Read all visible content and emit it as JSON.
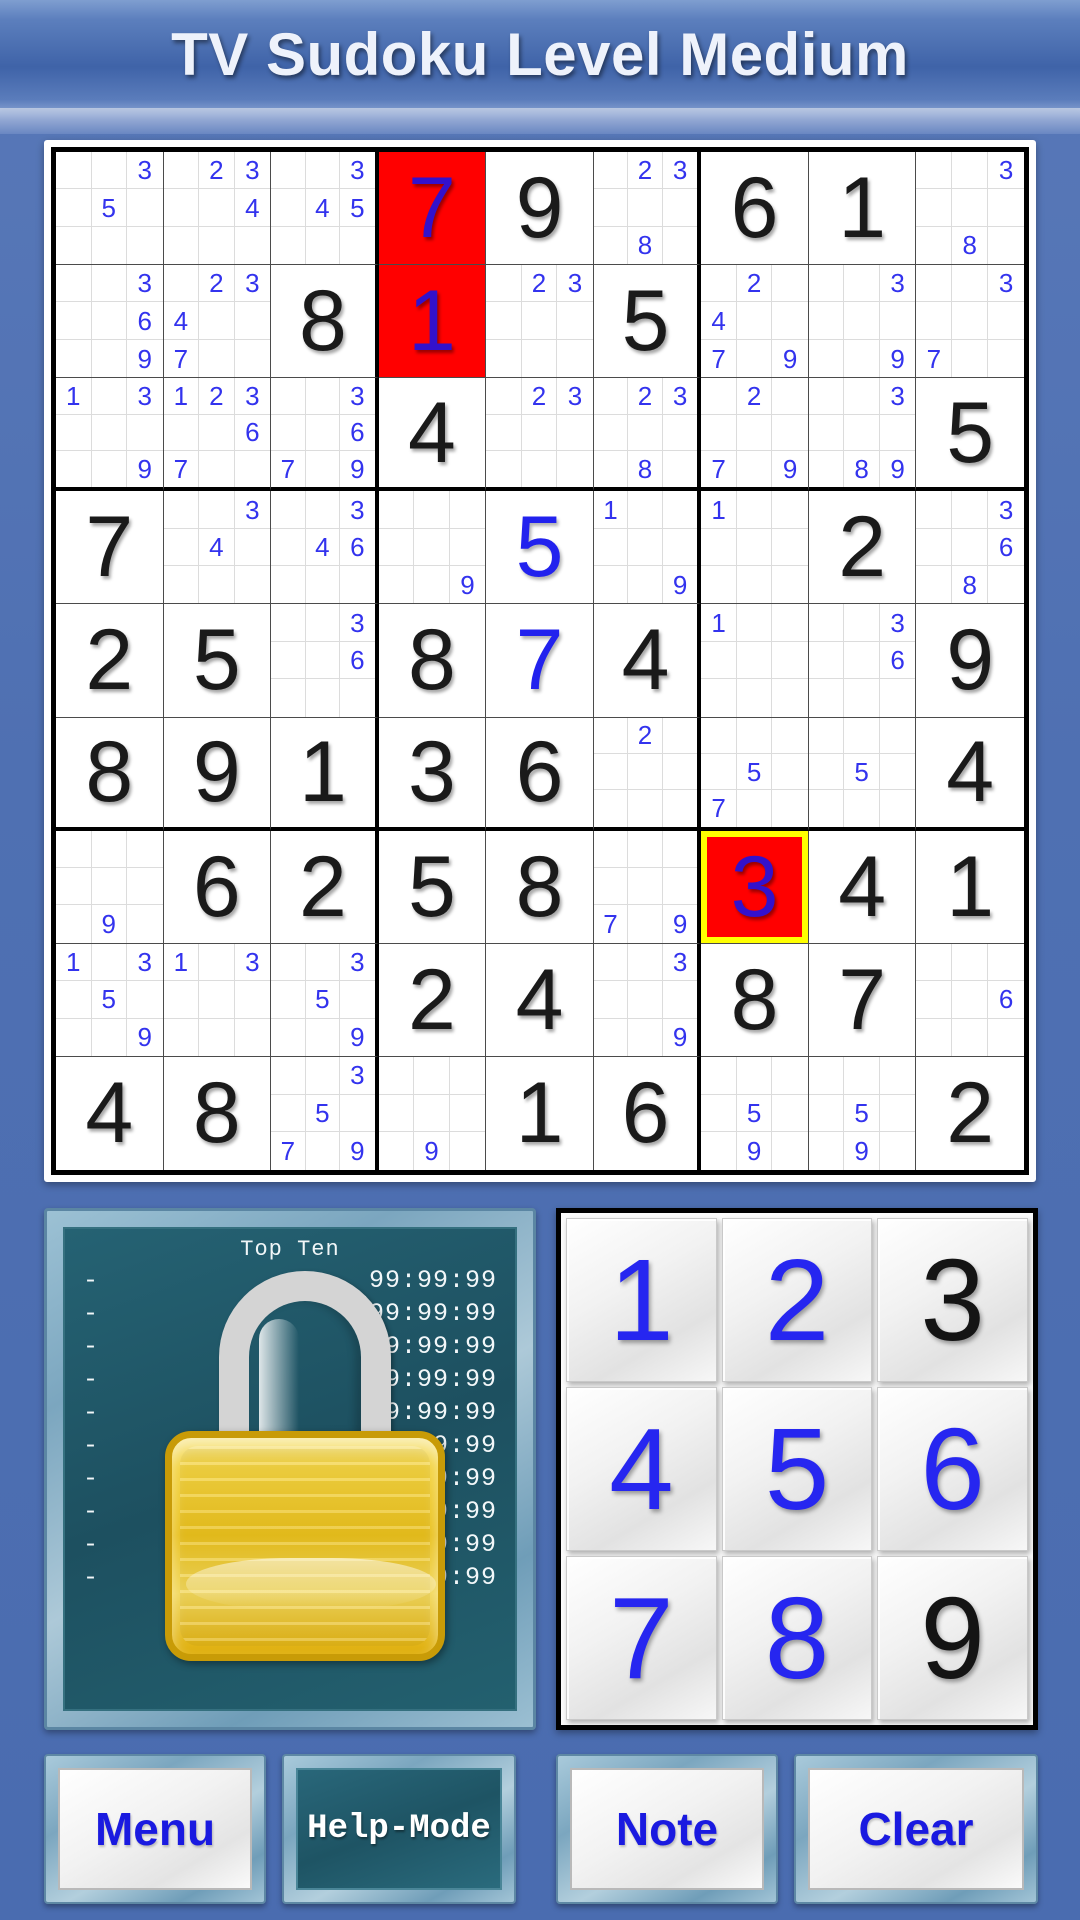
{
  "header": {
    "title": "TV Sudoku Level Medium"
  },
  "board": {
    "selected_cells": [
      {
        "row": 1,
        "col": 3,
        "style": "red"
      },
      {
        "row": 6,
        "col": 6,
        "style": "red-yellow"
      }
    ],
    "cells": [
      [
        {
          "notes": [
            null,
            null,
            "3",
            null,
            "5",
            null,
            null,
            null,
            null
          ]
        },
        {
          "notes": [
            null,
            "2",
            "3",
            null,
            null,
            "4",
            null,
            null,
            null
          ]
        },
        {
          "notes": [
            null,
            null,
            "3",
            null,
            "4",
            "5",
            null,
            null,
            null
          ]
        },
        {
          "value": "7",
          "kind": "user",
          "highlight": "red"
        },
        {
          "value": "9",
          "kind": "given"
        },
        {
          "notes": [
            null,
            "2",
            "3",
            null,
            null,
            null,
            null,
            "8",
            null
          ]
        },
        {
          "value": "6",
          "kind": "given"
        },
        {
          "value": "1",
          "kind": "given"
        },
        {
          "notes": [
            null,
            null,
            "3",
            null,
            null,
            null,
            null,
            "8",
            null
          ]
        }
      ],
      [
        {
          "notes": [
            null,
            null,
            "3",
            null,
            null,
            "6",
            null,
            null,
            "9"
          ]
        },
        {
          "notes": [
            null,
            "2",
            "3",
            "4",
            null,
            null,
            "7",
            null,
            null
          ]
        },
        {
          "value": "8",
          "kind": "given"
        },
        {
          "value": "1",
          "kind": "user",
          "highlight": "red"
        },
        {
          "notes": [
            null,
            "2",
            "3",
            null,
            null,
            null,
            null,
            null,
            null
          ]
        },
        {
          "value": "5",
          "kind": "given"
        },
        {
          "notes": [
            null,
            "2",
            null,
            "4",
            null,
            null,
            "7",
            null,
            "9"
          ]
        },
        {
          "notes": [
            null,
            null,
            "3",
            null,
            null,
            null,
            null,
            null,
            "9"
          ]
        },
        {
          "notes": [
            null,
            null,
            "3",
            null,
            null,
            null,
            "7",
            null,
            null
          ]
        }
      ],
      [
        {
          "notes": [
            "1",
            null,
            "3",
            null,
            null,
            null,
            null,
            null,
            "9"
          ]
        },
        {
          "notes": [
            "1",
            "2",
            "3",
            null,
            null,
            "6",
            "7",
            null,
            null
          ]
        },
        {
          "notes": [
            null,
            null,
            "3",
            null,
            null,
            "6",
            "7",
            null,
            "9"
          ]
        },
        {
          "value": "4",
          "kind": "given"
        },
        {
          "notes": [
            null,
            "2",
            "3",
            null,
            null,
            null,
            null,
            null,
            null
          ]
        },
        {
          "notes": [
            null,
            "2",
            "3",
            null,
            null,
            null,
            null,
            "8",
            null
          ]
        },
        {
          "notes": [
            null,
            "2",
            null,
            null,
            null,
            null,
            "7",
            null,
            "9"
          ]
        },
        {
          "notes": [
            null,
            null,
            "3",
            null,
            null,
            null,
            null,
            "8",
            "9"
          ]
        },
        {
          "value": "5",
          "kind": "given"
        }
      ],
      [
        {
          "value": "7",
          "kind": "given"
        },
        {
          "notes": [
            null,
            null,
            "3",
            null,
            "4",
            null,
            null,
            null,
            null
          ]
        },
        {
          "notes": [
            null,
            null,
            "3",
            null,
            "4",
            "6",
            null,
            null,
            null
          ]
        },
        {
          "notes": [
            null,
            null,
            null,
            null,
            null,
            null,
            null,
            null,
            "9"
          ]
        },
        {
          "value": "5",
          "kind": "user"
        },
        {
          "notes": [
            "1",
            null,
            null,
            null,
            null,
            null,
            null,
            null,
            "9"
          ]
        },
        {
          "notes": [
            "1",
            null,
            null,
            null,
            null,
            null,
            null,
            null,
            null
          ]
        },
        {
          "value": "2",
          "kind": "given"
        },
        {
          "notes": [
            null,
            null,
            "3",
            null,
            null,
            "6",
            null,
            "8",
            null
          ]
        }
      ],
      [
        {
          "value": "2",
          "kind": "given"
        },
        {
          "value": "5",
          "kind": "given"
        },
        {
          "notes": [
            null,
            null,
            "3",
            null,
            null,
            "6",
            null,
            null,
            null
          ]
        },
        {
          "value": "8",
          "kind": "given"
        },
        {
          "value": "7",
          "kind": "user"
        },
        {
          "value": "4",
          "kind": "given"
        },
        {
          "notes": [
            "1",
            null,
            null,
            null,
            null,
            null,
            null,
            null,
            null
          ]
        },
        {
          "notes": [
            null,
            null,
            "3",
            null,
            null,
            "6",
            null,
            null,
            null
          ]
        },
        {
          "value": "9",
          "kind": "given"
        }
      ],
      [
        {
          "value": "8",
          "kind": "given"
        },
        {
          "value": "9",
          "kind": "given"
        },
        {
          "value": "1",
          "kind": "given"
        },
        {
          "value": "3",
          "kind": "given"
        },
        {
          "value": "6",
          "kind": "given"
        },
        {
          "notes": [
            null,
            "2",
            null,
            null,
            null,
            null,
            null,
            null,
            null
          ]
        },
        {
          "notes": [
            null,
            null,
            null,
            null,
            "5",
            null,
            "7",
            null,
            null
          ]
        },
        {
          "notes": [
            null,
            null,
            null,
            null,
            "5",
            null,
            null,
            null,
            null
          ]
        },
        {
          "value": "4",
          "kind": "given"
        }
      ],
      [
        {
          "notes": [
            null,
            null,
            null,
            null,
            null,
            null,
            null,
            "9",
            null
          ]
        },
        {
          "value": "6",
          "kind": "given"
        },
        {
          "value": "2",
          "kind": "given"
        },
        {
          "value": "5",
          "kind": "given"
        },
        {
          "value": "8",
          "kind": "given"
        },
        {
          "notes": [
            null,
            null,
            null,
            null,
            null,
            null,
            "7",
            null,
            "9"
          ]
        },
        {
          "value": "3",
          "kind": "user",
          "highlight": "red-yellow"
        },
        {
          "value": "4",
          "kind": "given"
        },
        {
          "value": "1",
          "kind": "given"
        }
      ],
      [
        {
          "notes": [
            "1",
            null,
            "3",
            null,
            "5",
            null,
            null,
            null,
            "9"
          ]
        },
        {
          "notes": [
            "1",
            null,
            "3",
            null,
            null,
            null,
            null,
            null,
            null
          ]
        },
        {
          "notes": [
            null,
            null,
            "3",
            null,
            "5",
            null,
            null,
            null,
            "9"
          ]
        },
        {
          "value": "2",
          "kind": "given"
        },
        {
          "value": "4",
          "kind": "given"
        },
        {
          "notes": [
            null,
            null,
            "3",
            null,
            null,
            null,
            null,
            null,
            "9"
          ]
        },
        {
          "value": "8",
          "kind": "given"
        },
        {
          "value": "7",
          "kind": "given"
        },
        {
          "notes": [
            null,
            null,
            null,
            null,
            null,
            "6",
            null,
            null,
            null
          ]
        }
      ],
      [
        {
          "value": "4",
          "kind": "given"
        },
        {
          "value": "8",
          "kind": "given"
        },
        {
          "notes": [
            null,
            null,
            "3",
            null,
            "5",
            null,
            "7",
            null,
            "9"
          ]
        },
        {
          "notes": [
            null,
            null,
            null,
            null,
            null,
            null,
            null,
            "9",
            null
          ]
        },
        {
          "value": "1",
          "kind": "given"
        },
        {
          "value": "6",
          "kind": "given"
        },
        {
          "notes": [
            null,
            null,
            null,
            null,
            "5",
            null,
            null,
            "9",
            null
          ]
        },
        {
          "notes": [
            null,
            null,
            null,
            null,
            "5",
            null,
            null,
            "9",
            null
          ]
        },
        {
          "value": "2",
          "kind": "given"
        }
      ]
    ]
  },
  "topten": {
    "header": "Top Ten",
    "entries": [
      {
        "name": "-",
        "time": "99:99:99"
      },
      {
        "name": "-",
        "time": "99:99:99"
      },
      {
        "name": "-",
        "time": "99:99:99"
      },
      {
        "name": "-",
        "time": "99:99:99"
      },
      {
        "name": "-",
        "time": "99:99:99"
      },
      {
        "name": "-",
        "time": "99:99:99"
      },
      {
        "name": "-",
        "time": "99:99:99"
      },
      {
        "name": "-",
        "time": "99:99:99"
      },
      {
        "name": "-",
        "time": "99:99:99"
      },
      {
        "name": "-",
        "time": "99:99:99"
      }
    ],
    "lock_icon": "padlock-icon"
  },
  "numpad": {
    "keys": [
      {
        "label": "1",
        "color": "blue"
      },
      {
        "label": "2",
        "color": "blue"
      },
      {
        "label": "3",
        "color": "dark"
      },
      {
        "label": "4",
        "color": "blue"
      },
      {
        "label": "5",
        "color": "blue"
      },
      {
        "label": "6",
        "color": "blue"
      },
      {
        "label": "7",
        "color": "blue"
      },
      {
        "label": "8",
        "color": "blue"
      },
      {
        "label": "9",
        "color": "dark"
      }
    ]
  },
  "buttons": {
    "menu": "Menu",
    "help_mode": "Help-Mode",
    "note": "Note",
    "clear": "Clear"
  },
  "colors": {
    "accent_blue": "#2222ee",
    "selected_red": "#ff0000",
    "selected_outline": "#ffff00",
    "title_bg": "#3f63a8",
    "lock_yellow": "#f3d23f"
  }
}
